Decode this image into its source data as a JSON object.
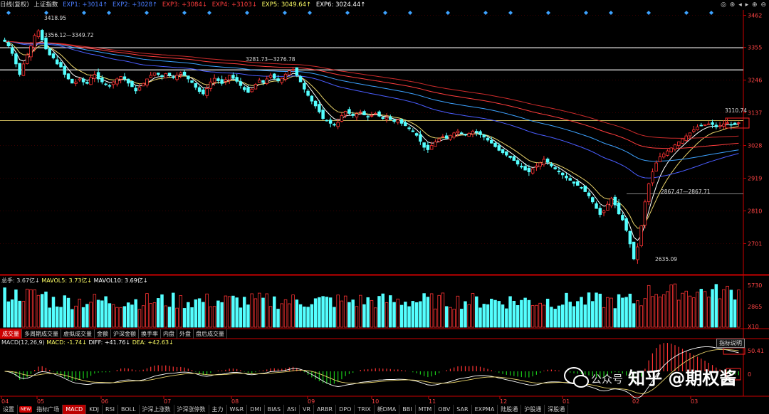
{
  "topbar": {
    "mode": "日线(复权)",
    "name": "上证指数",
    "items": [
      {
        "label": "EXP1: +3014↑",
        "color": "#4a7dff"
      },
      {
        "label": "EXP2: +3028↑",
        "color": "#4a7dff"
      },
      {
        "label": "EXP3: +3084↓",
        "color": "#ff3d3d"
      },
      {
        "label": "EXP4: +3103↓",
        "color": "#ff3d3d"
      },
      {
        "label": "EXP5: 3049.64↑",
        "color": "#ffff66"
      },
      {
        "label": "EXP6: 3024.44↑",
        "color": "#ffffff"
      }
    ]
  },
  "main": {
    "y_ticks": [
      "3462",
      "3355",
      "3246",
      "3137",
      "3028",
      "2919",
      "2810",
      "2701"
    ],
    "annotations": [
      {
        "text": "3418.95"
      },
      {
        "text": "3356.12—3349.72"
      },
      {
        "text": "3281.73—3276.78"
      },
      {
        "text": "3110.74"
      },
      {
        "text": "2867.47—2867.71"
      },
      {
        "text": "2635.09"
      }
    ]
  },
  "volume": {
    "label": {
      "a": "总手: 3.67亿↓",
      "b": "MAVOL5: 3.73亿↓",
      "c": "MAVOL10: 3.69亿↓"
    },
    "y_ticks": [
      "5730",
      "2865",
      "X10"
    ]
  },
  "indicator_tabs": [
    "成交量",
    "多周期成交量",
    "虚拟成交量",
    "金额",
    "沪深金额",
    "换手率",
    "内盘",
    "外盘",
    "盘后成交量"
  ],
  "macd": {
    "label": {
      "name": "MACD(12,26,9)",
      "macd": "MACD: -1.74↓",
      "diff": "DIFF: +41.76↓",
      "dea": "DEA: +42.63↓"
    },
    "y_ticks": [
      "50.41",
      "0"
    ],
    "button": "指标说明"
  },
  "x_axis": [
    "04",
    "05",
    "06",
    "07",
    "08",
    "09",
    "10",
    "11",
    "12",
    "01",
    "02",
    "03"
  ],
  "bottom_tabs": [
    "设置",
    "NEW",
    "指标广场",
    "MACD",
    "KDJ",
    "RSI",
    "BOLL",
    "沪深上涨数",
    "沪深涨停数",
    "主力",
    "W&R",
    "DMI",
    "BIAS",
    "ASI",
    "VR",
    "ARBR",
    "DPO",
    "TRIX",
    "新DMA",
    "BBI",
    "MTM",
    "OBV",
    "SAR",
    "EXPMA",
    "陆股通",
    "沪股通",
    "深股通"
  ],
  "watermark": {
    "text": "知乎 @期权酱",
    "sub": "公众号"
  },
  "chart_data": {
    "type": "candlestick",
    "y_range": [
      2600,
      3480
    ],
    "close_series": [
      3375,
      3360,
      3335,
      3300,
      3265,
      3300,
      3330,
      3360,
      3395,
      3410,
      3380,
      3350,
      3330,
      3320,
      3300,
      3290,
      3265,
      3250,
      3236,
      3240,
      3250,
      3240,
      3235,
      3255,
      3265,
      3250,
      3240,
      3232,
      3228,
      3240,
      3250,
      3258,
      3250,
      3236,
      3224,
      3210,
      3222,
      3235,
      3250,
      3262,
      3270,
      3265,
      3258,
      3268,
      3262,
      3255,
      3262,
      3270,
      3262,
      3250,
      3238,
      3222,
      3208,
      3200,
      3218,
      3240,
      3252,
      3244,
      3235,
      3248,
      3262,
      3252,
      3242,
      3228,
      3214,
      3205,
      3216,
      3232,
      3246,
      3238,
      3250,
      3262,
      3252,
      3244,
      3252,
      3266,
      3277,
      3282,
      3262,
      3240,
      3216,
      3195,
      3176,
      3160,
      3140,
      3118,
      3110,
      3102,
      3096,
      3105,
      3128,
      3142,
      3135,
      3128,
      3134,
      3140,
      3130,
      3124,
      3128,
      3135,
      3126,
      3118,
      3122,
      3114,
      3108,
      3114,
      3102,
      3094,
      3084,
      3074,
      3062,
      3042,
      3022,
      3014,
      3028,
      3040,
      3050,
      3058,
      3052,
      3062,
      3070,
      3076,
      3070,
      3064,
      3068,
      3076,
      3072,
      3064,
      3056,
      3046,
      3036,
      3024,
      3012,
      3004,
      2996,
      2988,
      2978,
      2966,
      2956,
      2946,
      2940,
      2950,
      2960,
      2970,
      2982,
      2972,
      2960,
      2950,
      2940,
      2930,
      2920,
      2912,
      2902,
      2895,
      2886,
      2874,
      2860,
      2840,
      2818,
      2798,
      2810,
      2832,
      2852,
      2830,
      2800,
      2780,
      2745,
      2700,
      2650,
      2690,
      2760,
      2840,
      2900,
      2940,
      2970,
      2990,
      3000,
      3010,
      3020,
      3030,
      3040,
      3050,
      3060,
      3070,
      3080,
      3090,
      3095,
      3098,
      3100,
      3098,
      3090,
      3094,
      3100,
      3104,
      3096,
      3098,
      3104
    ],
    "volume_range": [
      0,
      5730
    ],
    "macd_range": [
      -60,
      60
    ]
  },
  "colors": {
    "up": "#ff3333",
    "down": "#54ffff",
    "grid": "#5a0000",
    "axis": "#cc0000",
    "text": "#cccccc"
  }
}
